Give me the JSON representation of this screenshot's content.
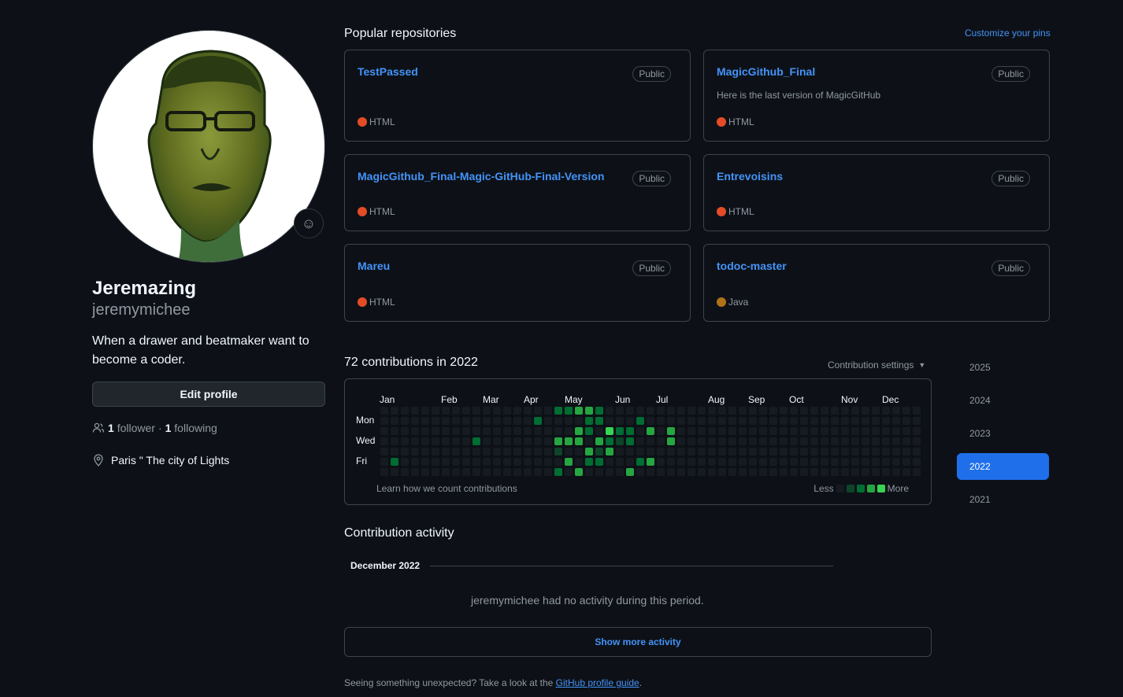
{
  "profile": {
    "full_name": "Jeremazing",
    "username": "jeremymichee",
    "bio": "When a drawer and beatmaker want to become a coder.",
    "edit_label": "Edit profile",
    "followers_count": "1",
    "followers_label": "follower",
    "separator": "·",
    "following_count": "1",
    "following_label": "following",
    "location": "Paris \" The city of Lights",
    "emoji_icon": "smiley-icon"
  },
  "pinned": {
    "title": "Popular repositories",
    "customize_label": "Customize your pins",
    "repos": [
      {
        "name": "TestPassed",
        "badge": "Public",
        "description": "",
        "language": "HTML",
        "lang_color": "#e34c26"
      },
      {
        "name": "MagicGithub_Final",
        "badge": "Public",
        "description": "Here is the last version of MagicGitHub",
        "language": "HTML",
        "lang_color": "#e34c26"
      },
      {
        "name": "MagicGithub_Final-Magic-GitHub-Final-Version",
        "badge": "Public",
        "description": "",
        "language": "HTML",
        "lang_color": "#e34c26"
      },
      {
        "name": "Entrevoisins",
        "badge": "Public",
        "description": "",
        "language": "HTML",
        "lang_color": "#e34c26"
      },
      {
        "name": "Mareu",
        "badge": "Public",
        "description": "",
        "language": "HTML",
        "lang_color": "#e34c26"
      },
      {
        "name": "todoc-master",
        "badge": "Public",
        "description": "",
        "language": "Java",
        "lang_color": "#b07219"
      }
    ]
  },
  "contributions": {
    "title": "72 contributions in 2022",
    "settings_label": "Contribution settings",
    "months": [
      "Jan",
      "Feb",
      "Mar",
      "Apr",
      "May",
      "Jun",
      "Jul",
      "Aug",
      "Sep",
      "Oct",
      "Nov",
      "Dec"
    ],
    "days": [
      "Mon",
      "Wed",
      "Fri"
    ],
    "learn_label": "Learn how we count contributions",
    "less_label": "Less",
    "more_label": "More",
    "level_colors": [
      "#161b22",
      "#0e4429",
      "#006d32",
      "#26a641",
      "#39d353"
    ],
    "weeks": 53,
    "active_cells": [
      {
        "week": 1,
        "day": 5,
        "level": 2
      },
      {
        "week": 9,
        "day": 3,
        "level": 2
      },
      {
        "week": 15,
        "day": 1,
        "level": 2
      },
      {
        "week": 17,
        "day": 0,
        "level": 2
      },
      {
        "week": 18,
        "day": 0,
        "level": 2
      },
      {
        "week": 17,
        "day": 3,
        "level": 3
      },
      {
        "week": 17,
        "day": 4,
        "level": 1
      },
      {
        "week": 17,
        "day": 6,
        "level": 2
      },
      {
        "week": 18,
        "day": 3,
        "level": 3
      },
      {
        "week": 18,
        "day": 5,
        "level": 3
      },
      {
        "week": 19,
        "day": 0,
        "level": 3
      },
      {
        "week": 19,
        "day": 2,
        "level": 3
      },
      {
        "week": 19,
        "day": 3,
        "level": 3
      },
      {
        "week": 19,
        "day": 6,
        "level": 3
      },
      {
        "week": 20,
        "day": 0,
        "level": 3
      },
      {
        "week": 20,
        "day": 1,
        "level": 2
      },
      {
        "week": 20,
        "day": 2,
        "level": 2
      },
      {
        "week": 20,
        "day": 4,
        "level": 3
      },
      {
        "week": 20,
        "day": 5,
        "level": 2
      },
      {
        "week": 19,
        "day": 7,
        "level": 4
      },
      {
        "week": 20,
        "day": 7,
        "level": 1
      },
      {
        "week": 21,
        "day": 0,
        "level": 2
      },
      {
        "week": 21,
        "day": 1,
        "level": 2
      },
      {
        "week": 21,
        "day": 3,
        "level": 3
      },
      {
        "week": 21,
        "day": 4,
        "level": 1
      },
      {
        "week": 21,
        "day": 5,
        "level": 2
      },
      {
        "week": 21,
        "day": 7,
        "level": 2
      },
      {
        "week": 22,
        "day": 2,
        "level": 4
      },
      {
        "week": 22,
        "day": 3,
        "level": 2
      },
      {
        "week": 22,
        "day": 4,
        "level": 3
      },
      {
        "week": 22,
        "day": 7,
        "level": 2
      },
      {
        "week": 23,
        "day": 2,
        "level": 2
      },
      {
        "week": 23,
        "day": 3,
        "level": 1
      },
      {
        "week": 24,
        "day": 2,
        "level": 2
      },
      {
        "week": 24,
        "day": 3,
        "level": 2
      },
      {
        "week": 24,
        "day": 6,
        "level": 3
      },
      {
        "week": 25,
        "day": 1,
        "level": 2
      },
      {
        "week": 25,
        "day": 5,
        "level": 2
      },
      {
        "week": 26,
        "day": 2,
        "level": 3
      },
      {
        "week": 26,
        "day": 5,
        "level": 3
      },
      {
        "week": 28,
        "day": 2,
        "level": 3
      },
      {
        "week": 28,
        "day": 3,
        "level": 3
      }
    ]
  },
  "years": [
    "2025",
    "2024",
    "2023",
    "2022",
    "2021"
  ],
  "active_year": "2022",
  "activity": {
    "title": "Contribution activity",
    "month_label": "December 2022",
    "empty_text": "jeremymichee had no activity during this period.",
    "show_more_label": "Show more activity"
  },
  "footer": {
    "text": "Seeing something unexpected? Take a look at the",
    "link_label": "GitHub profile guide",
    "end": "."
  }
}
